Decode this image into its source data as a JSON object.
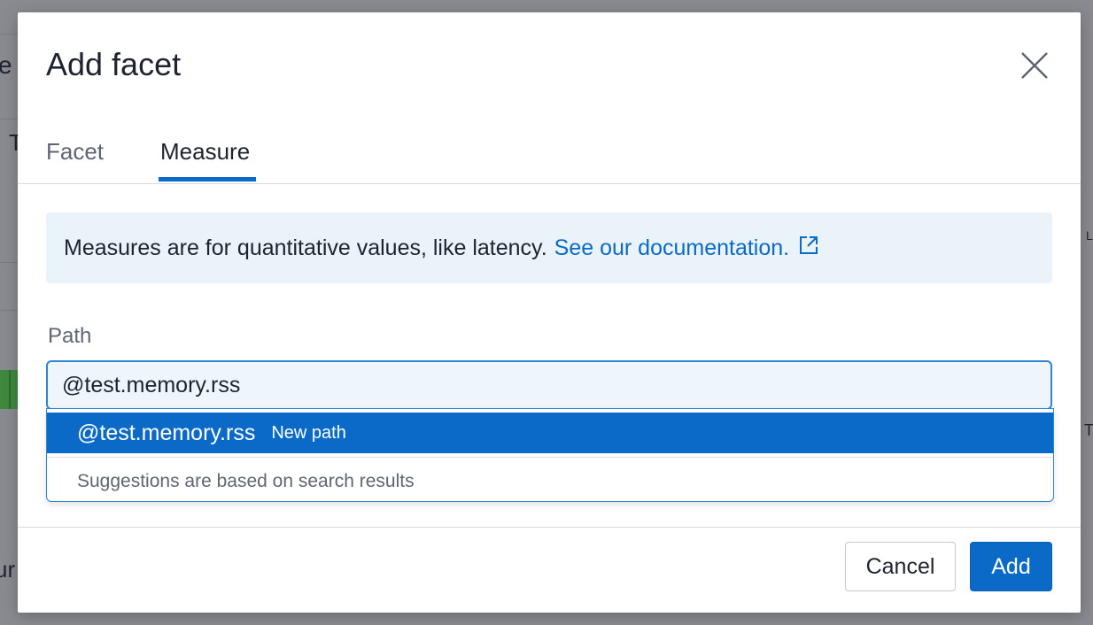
{
  "background": {
    "fragments": [
      "e",
      "T",
      "ur",
      "L",
      "T"
    ]
  },
  "modal": {
    "title": "Add facet",
    "close_icon": "close-icon"
  },
  "tabs": [
    {
      "label": "Facet",
      "active": false
    },
    {
      "label": "Measure",
      "active": true
    }
  ],
  "info": {
    "text": "Measures are for quantitative values, like latency.",
    "link_text": "See our documentation.",
    "link_icon": "external-link-icon"
  },
  "path": {
    "label": "Path",
    "value": "@test.memory.rss"
  },
  "dropdown": {
    "option_value": "@test.memory.rss",
    "option_tag": "New path",
    "hint": "Suggestions are based on search results"
  },
  "footer": {
    "cancel_label": "Cancel",
    "add_label": "Add"
  },
  "colors": {
    "accent": "#0b6ac8",
    "info_bg": "#eaf3fa",
    "input_bg": "#eef6fc"
  }
}
